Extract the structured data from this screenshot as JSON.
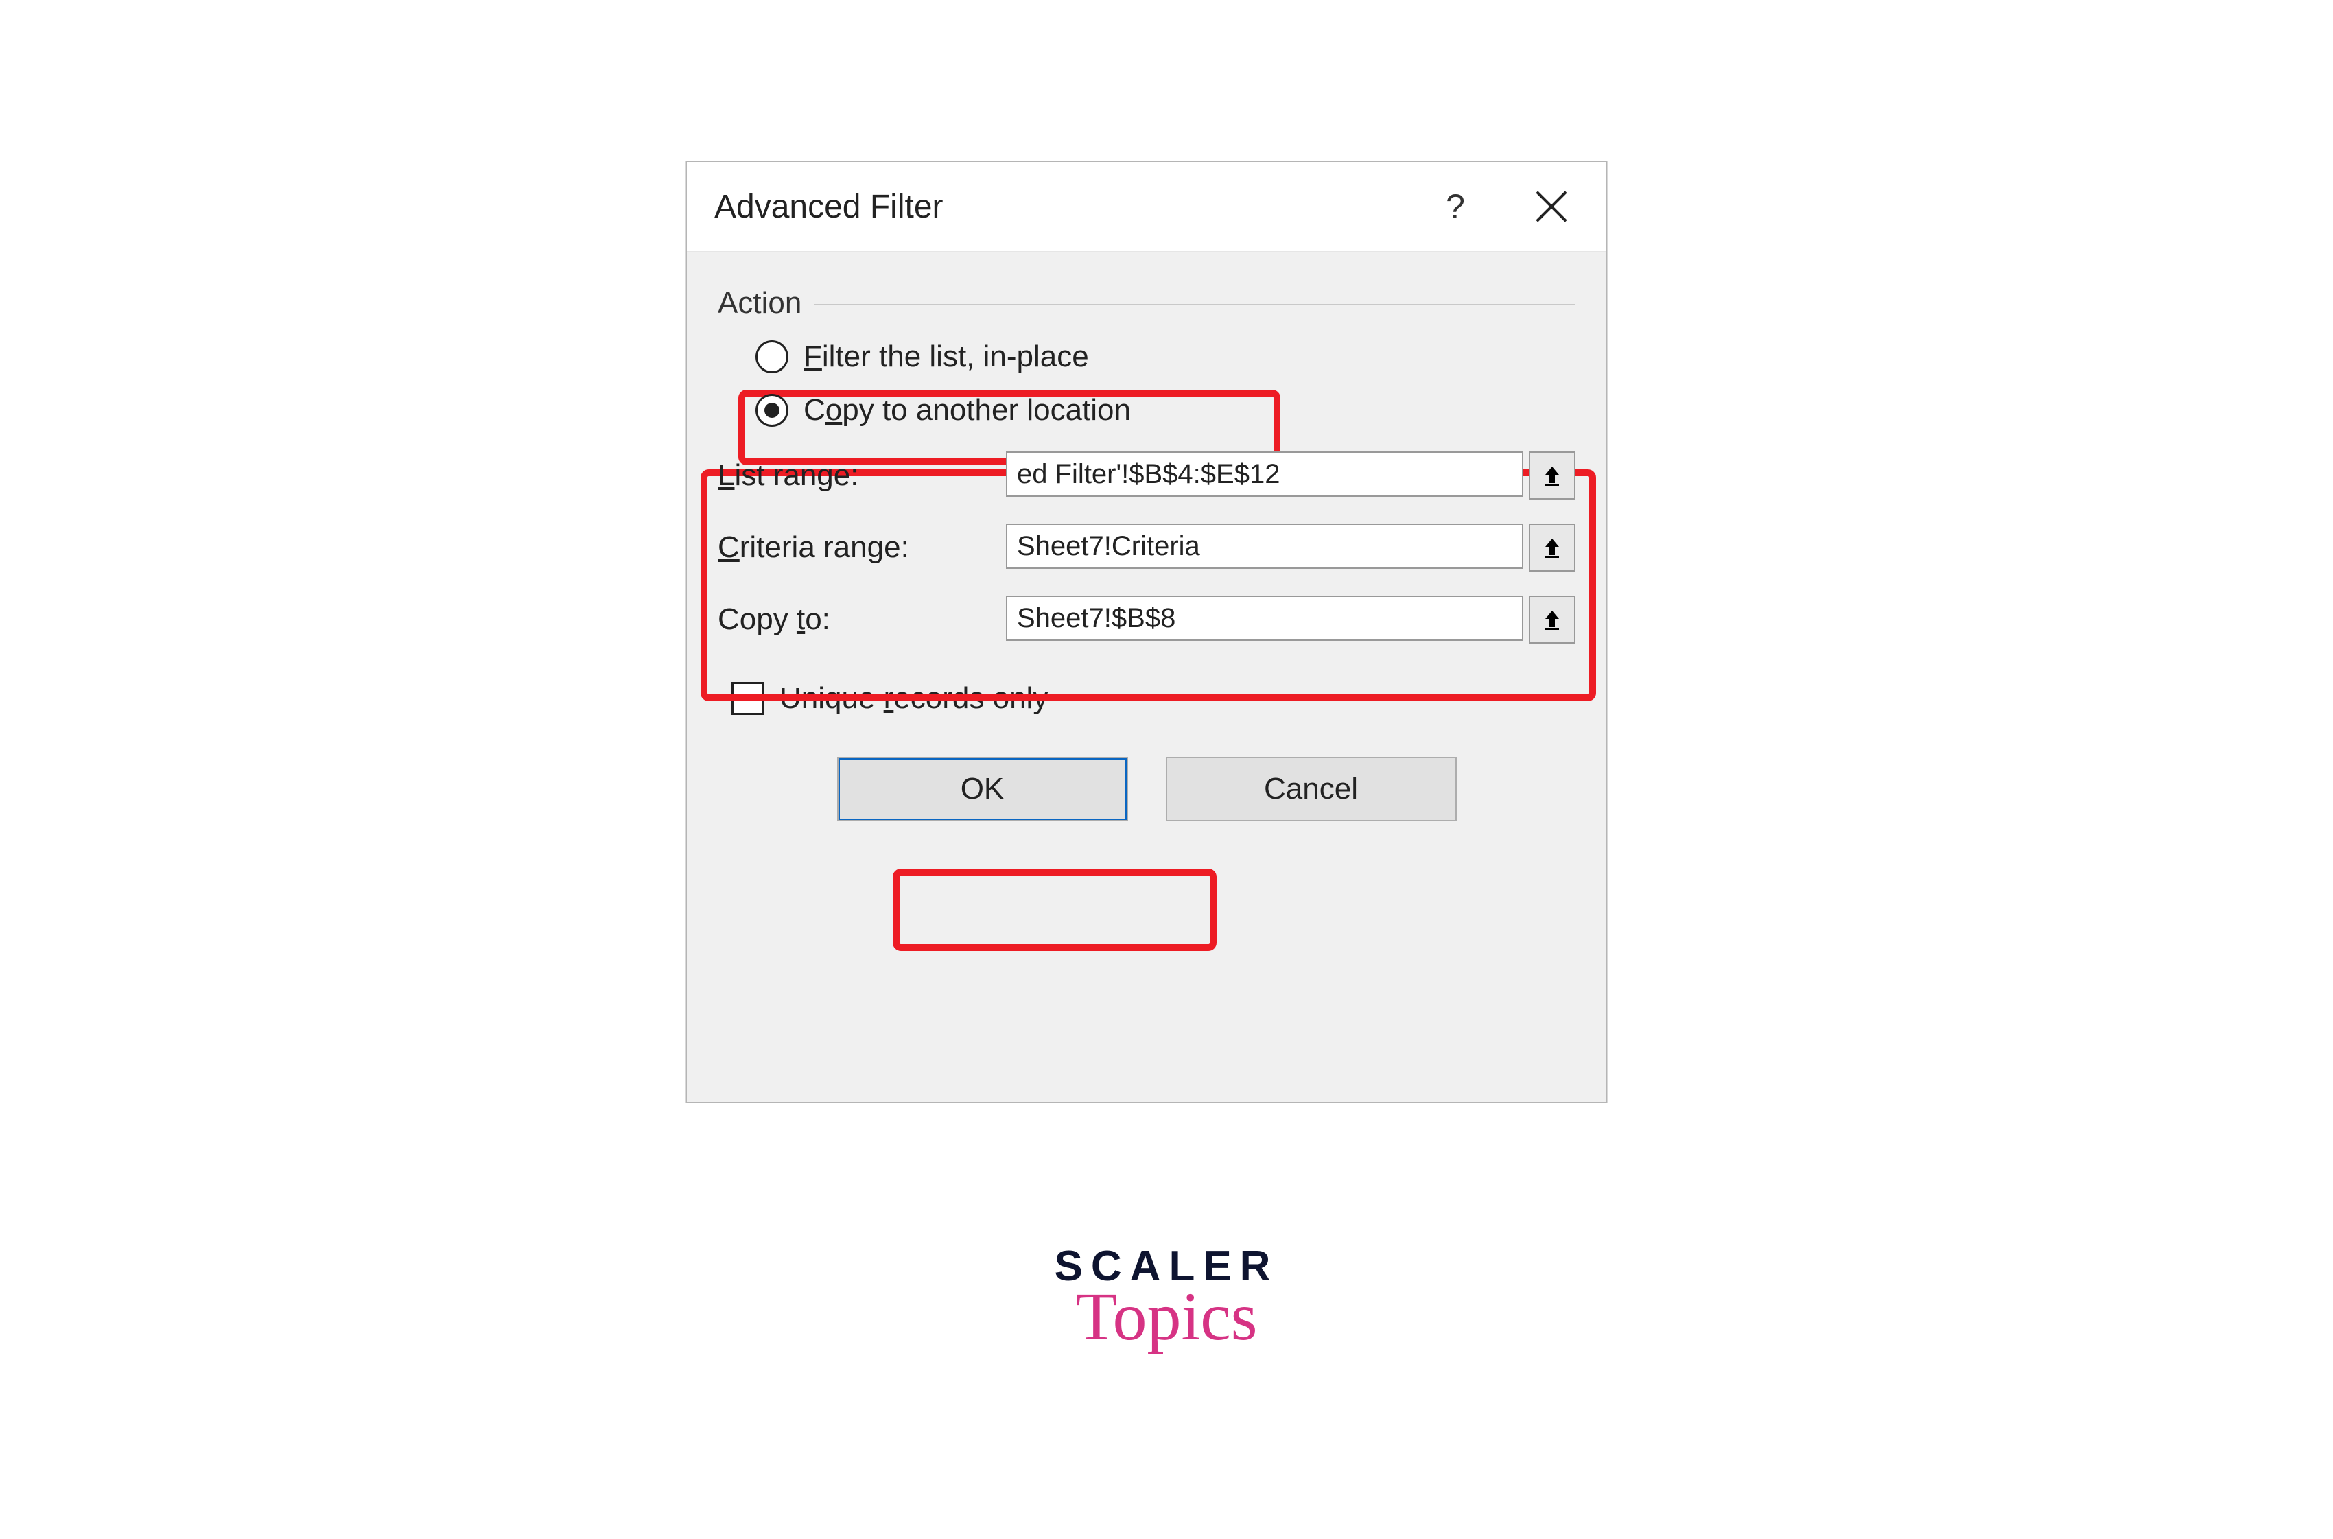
{
  "dialog": {
    "title": "Advanced Filter",
    "help_symbol": "?",
    "group_action": "Action",
    "radio_filter_in_place": "Filter the list, in-place",
    "radio_copy_another": "Copy to another location",
    "label_list_range": "List range:",
    "label_criteria_range": "Criteria range:",
    "label_copy_to": "Copy to:",
    "input_list_range": "ed Filter'!$B$4:$E$12",
    "input_criteria_range": "Sheet7!Criteria",
    "input_copy_to": "Sheet7!$B$8",
    "check_unique": "Unique records only",
    "btn_ok": "OK",
    "btn_cancel": "Cancel"
  },
  "logo": {
    "line1": "SCALER",
    "line2": "Topics"
  }
}
